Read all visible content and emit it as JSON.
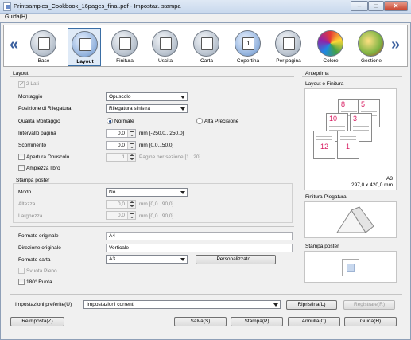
{
  "window": {
    "title": "Printsamples_Cookbook_16pages_final.pdf - Impostaz. stampa",
    "minimize": "–",
    "maximize": "□",
    "close": "✕"
  },
  "menu": {
    "guida": "Guida(H)"
  },
  "toolbar": {
    "left_arrow": "«",
    "right_arrow": "»",
    "tabs": [
      {
        "label": "Base",
        "icon": "base-icon"
      },
      {
        "label": "Layout",
        "icon": "layout-icon"
      },
      {
        "label": "Finitura",
        "icon": "finishing-icon"
      },
      {
        "label": "Uscita",
        "icon": "output-icon"
      },
      {
        "label": "Carta",
        "icon": "paper-icon"
      },
      {
        "label": "Copertina",
        "icon": "cover-icon"
      },
      {
        "label": "Per pagina",
        "icon": "per-page-icon"
      },
      {
        "label": "Colore",
        "icon": "color-icon"
      },
      {
        "label": "Gestione",
        "icon": "management-icon"
      }
    ],
    "cover_badge": "1"
  },
  "layout": {
    "title": "Layout",
    "due_lati": "2 Lati",
    "montaggio_label": "Montaggio",
    "montaggio_value": "Opuscolo",
    "posizione_label": "Posizione di Rilegatura",
    "posizione_value": "Rilegatura sinistra",
    "qualita_label": "Qualità Montaggio",
    "qualita_normale": "Normale",
    "qualita_alta": "Alta Precisione",
    "intervallo_label": "Intervallo pagina",
    "intervallo_value": "0,0",
    "intervallo_range": "mm [-250,0...250,0]",
    "scorrimento_label": "Scorrimento",
    "scorrimento_value": "0,0",
    "scorrimento_range": "mm [0,0...50,0]",
    "apertura_label": "Apertura Opuscolo",
    "apertura_value": "1",
    "apertura_range": "Pagine per sezione [1...20]",
    "ampiezza_label": "Ampiezza libro"
  },
  "poster": {
    "title": "Stampa poster",
    "modo_label": "Modo",
    "modo_value": "No",
    "altezza_label": "Altezza",
    "altezza_value": "0,0",
    "altezza_range": "mm [0,0...90,0]",
    "larghezza_label": "Larghezza",
    "larghezza_value": "0,0",
    "larghezza_range": "mm [0,0...90,0]"
  },
  "paper": {
    "formato_originale_label": "Formato originale",
    "formato_originale_value": "A4",
    "direzione_label": "Direzione originale",
    "direzione_value": "Verticale",
    "formato_carta_label": "Formato carta",
    "formato_carta_value": "A3",
    "personalizzato": "Personalizzato...",
    "svuota_pieno": "Svuota Pieno",
    "ruota": "180° Ruota"
  },
  "preview": {
    "title": "Anteprima",
    "layout_finitura": "Layout e Finitura",
    "paper_size": "A3",
    "paper_dims": "297,0 x 420,0 mm",
    "finitura_piegatura": "Finitura-Piegatura",
    "stampa_poster": "Stampa poster",
    "page_numbers": [
      "8",
      "5",
      "10",
      "3",
      "12",
      "1"
    ]
  },
  "footer": {
    "preferite_label": "Impostazioni preferite(U)",
    "preferite_value": "Impostazioni correnti",
    "ripristina": "Ripristina(L)",
    "registrare": "Registrare(R)",
    "reimposta": "Reimposta(Z)",
    "salva": "Salva(S)",
    "stampa": "Stampa(P)",
    "annulla": "Annulla(C)",
    "guida": "Guida(H)"
  }
}
